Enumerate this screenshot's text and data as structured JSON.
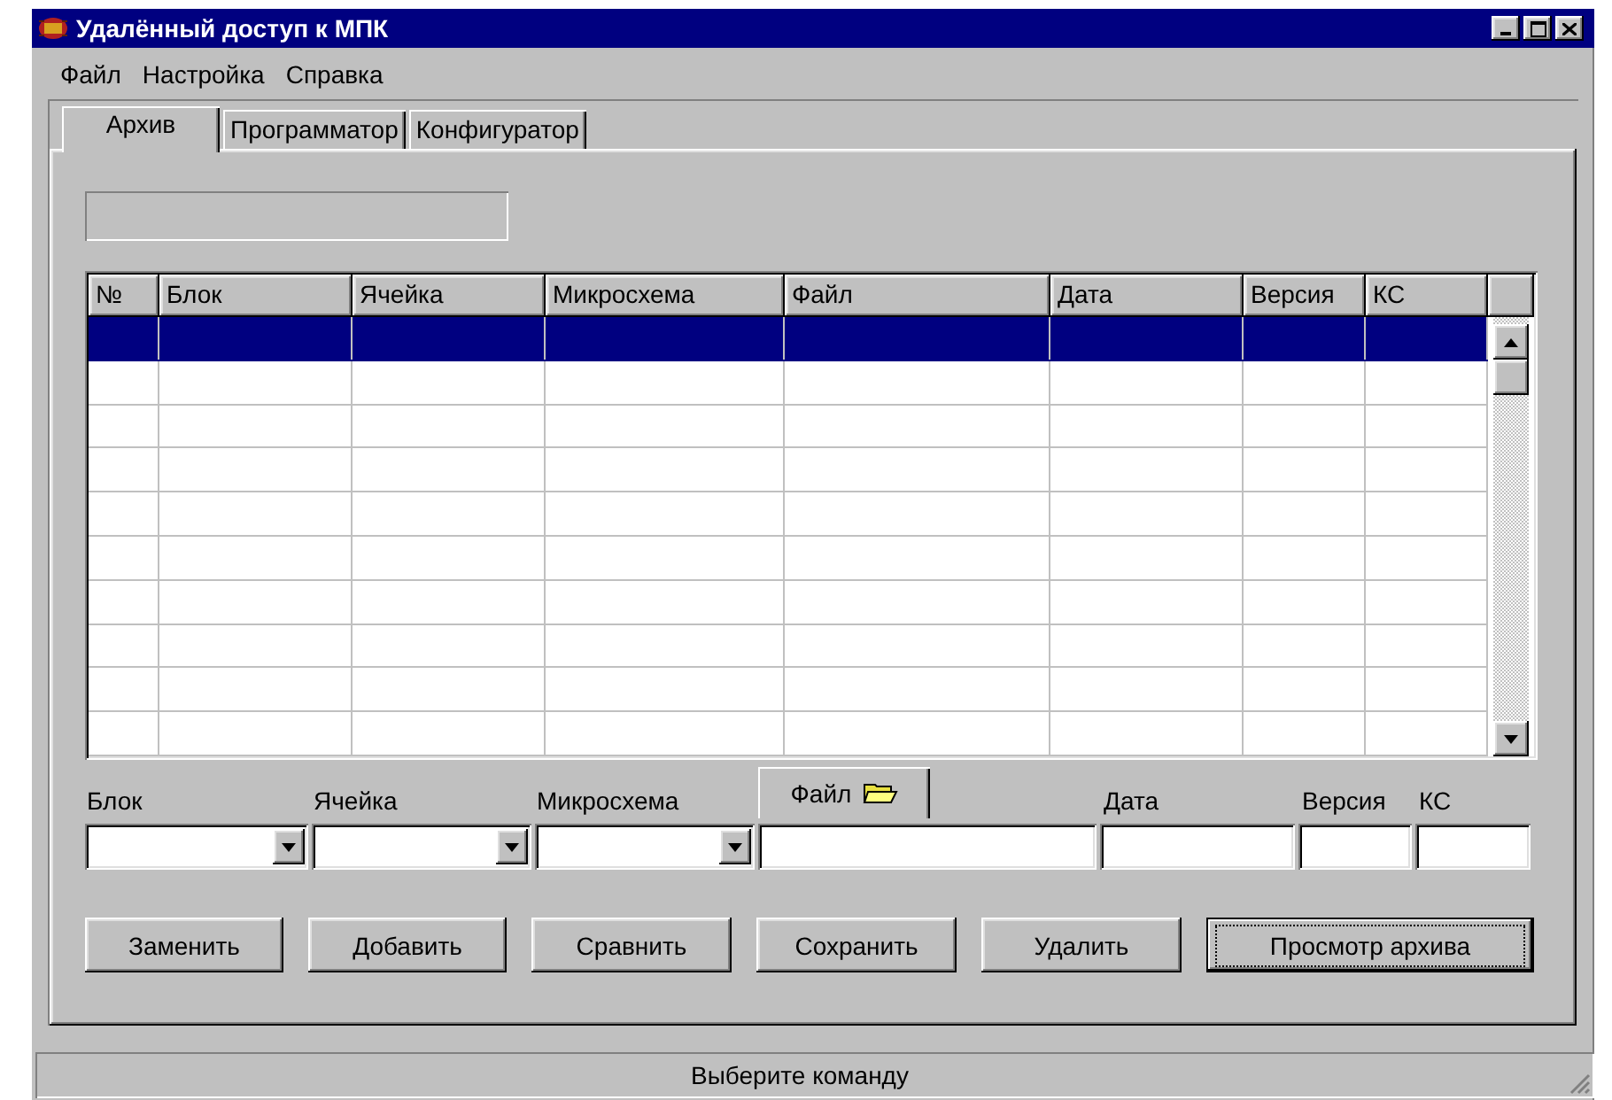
{
  "window": {
    "title": "Удалённый доступ к МПК"
  },
  "menu": [
    "Файл",
    "Настройка",
    "Справка"
  ],
  "tabs": [
    {
      "label": "Архив",
      "selected": true
    },
    {
      "label": "Программатор",
      "selected": false
    },
    {
      "label": "Конфигуратор",
      "selected": false
    }
  ],
  "table": {
    "columns": [
      "№",
      "Блок",
      "Ячейка",
      "Микросхема",
      "Файл",
      "Дата",
      "Версия",
      "КС"
    ],
    "rows": [
      {
        "selected": true
      },
      {
        "selected": false
      },
      {
        "selected": false
      },
      {
        "selected": false
      },
      {
        "selected": false
      },
      {
        "selected": false
      },
      {
        "selected": false
      },
      {
        "selected": false
      },
      {
        "selected": false
      },
      {
        "selected": false
      }
    ]
  },
  "form": {
    "fields": [
      {
        "kind": "dropdown",
        "label": "Блок"
      },
      {
        "kind": "dropdown",
        "label": "Ячейка"
      },
      {
        "kind": "dropdown",
        "label": "Микросхема"
      },
      {
        "kind": "file",
        "label": "Файл"
      },
      {
        "kind": "text",
        "label": "Дата"
      },
      {
        "kind": "text",
        "label": "Версия"
      },
      {
        "kind": "text",
        "label": "КС"
      }
    ]
  },
  "buttons": [
    {
      "label": "Заменить",
      "focused": false
    },
    {
      "label": "Добавить",
      "focused": false
    },
    {
      "label": "Сравнить",
      "focused": false
    },
    {
      "label": "Сохранить",
      "focused": false
    },
    {
      "label": "Удалить",
      "focused": false
    },
    {
      "label": "Просмотр архива",
      "focused": true
    }
  ],
  "status_bar": "Выберите команду"
}
